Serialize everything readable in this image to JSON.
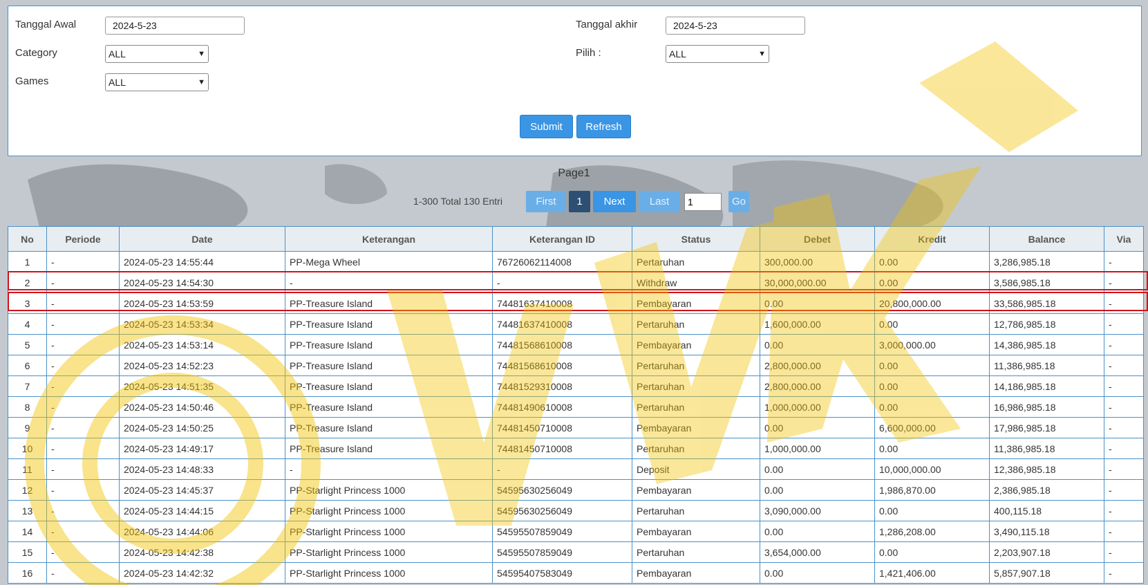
{
  "filters": {
    "start_date": {
      "label": "Tanggal Awal",
      "value": "2024-5-23"
    },
    "end_date": {
      "label": "Tanggal akhir",
      "value": "2024-5-23"
    },
    "category": {
      "label": "Category",
      "value": "ALL"
    },
    "pilih": {
      "label": "Pilih  :",
      "value": "ALL"
    },
    "games": {
      "label": "Games",
      "value": "ALL"
    },
    "submit_label": "Submit",
    "refresh_label": "Refresh"
  },
  "pagination": {
    "page_title": "Page1",
    "info": "1-300 Total 130 Entri",
    "first_label": "First",
    "current_page": "1",
    "next_label": "Next",
    "last_label": "Last",
    "page_input": "1",
    "go_label": "Go"
  },
  "table": {
    "headers": [
      "No",
      "Periode",
      "Date",
      "Keterangan",
      "Keterangan ID",
      "Status",
      "Debet",
      "Kredit",
      "Balance",
      "Via"
    ],
    "rows": [
      [
        "1",
        "-",
        "2024-05-23 14:55:44",
        "PP-Mega Wheel",
        "76726062114008",
        "Pertaruhan",
        "300,000.00",
        "0.00",
        "3,286,985.18",
        "-"
      ],
      [
        "2",
        "-",
        "2024-05-23 14:54:30",
        "-",
        "-",
        "Withdraw",
        "30,000,000.00",
        "0.00",
        "3,586,985.18",
        "-"
      ],
      [
        "3",
        "-",
        "2024-05-23 14:53:59",
        "PP-Treasure Island",
        "74481637410008",
        "Pembayaran",
        "0.00",
        "20,800,000.00",
        "33,586,985.18",
        "-"
      ],
      [
        "4",
        "-",
        "2024-05-23 14:53:34",
        "PP-Treasure Island",
        "74481637410008",
        "Pertaruhan",
        "1,600,000.00",
        "0.00",
        "12,786,985.18",
        "-"
      ],
      [
        "5",
        "-",
        "2024-05-23 14:53:14",
        "PP-Treasure Island",
        "74481568610008",
        "Pembayaran",
        "0.00",
        "3,000,000.00",
        "14,386,985.18",
        "-"
      ],
      [
        "6",
        "-",
        "2024-05-23 14:52:23",
        "PP-Treasure Island",
        "74481568610008",
        "Pertaruhan",
        "2,800,000.00",
        "0.00",
        "11,386,985.18",
        "-"
      ],
      [
        "7",
        "-",
        "2024-05-23 14:51:35",
        "PP-Treasure Island",
        "74481529310008",
        "Pertaruhan",
        "2,800,000.00",
        "0.00",
        "14,186,985.18",
        "-"
      ],
      [
        "8",
        "-",
        "2024-05-23 14:50:46",
        "PP-Treasure Island",
        "74481490610008",
        "Pertaruhan",
        "1,000,000.00",
        "0.00",
        "16,986,985.18",
        "-"
      ],
      [
        "9",
        "-",
        "2024-05-23 14:50:25",
        "PP-Treasure Island",
        "74481450710008",
        "Pembayaran",
        "0.00",
        "6,600,000.00",
        "17,986,985.18",
        "-"
      ],
      [
        "10",
        "-",
        "2024-05-23 14:49:17",
        "PP-Treasure Island",
        "74481450710008",
        "Pertaruhan",
        "1,000,000.00",
        "0.00",
        "11,386,985.18",
        "-"
      ],
      [
        "11",
        "-",
        "2024-05-23 14:48:33",
        "-",
        "-",
        "Deposit",
        "0.00",
        "10,000,000.00",
        "12,386,985.18",
        "-"
      ],
      [
        "12",
        "-",
        "2024-05-23 14:45:37",
        "PP-Starlight Princess 1000",
        "54595630256049",
        "Pembayaran",
        "0.00",
        "1,986,870.00",
        "2,386,985.18",
        "-"
      ],
      [
        "13",
        "-",
        "2024-05-23 14:44:15",
        "PP-Starlight Princess 1000",
        "54595630256049",
        "Pertaruhan",
        "3,090,000.00",
        "0.00",
        "400,115.18",
        "-"
      ],
      [
        "14",
        "-",
        "2024-05-23 14:44:06",
        "PP-Starlight Princess 1000",
        "54595507859049",
        "Pembayaran",
        "0.00",
        "1,286,208.00",
        "3,490,115.18",
        "-"
      ],
      [
        "15",
        "-",
        "2024-05-23 14:42:38",
        "PP-Starlight Princess 1000",
        "54595507859049",
        "Pertaruhan",
        "3,654,000.00",
        "0.00",
        "2,203,907.18",
        "-"
      ],
      [
        "16",
        "-",
        "2024-05-23 14:42:32",
        "PP-Starlight Princess 1000",
        "54595407583049",
        "Pembayaran",
        "0.00",
        "1,421,406.00",
        "5,857,907.18",
        "-"
      ]
    ],
    "withdraw_color": "#d0021b",
    "deposit_color": "#1a7f2a"
  },
  "highlight_color": "#d0121b",
  "watermark_color": "#f2c200"
}
